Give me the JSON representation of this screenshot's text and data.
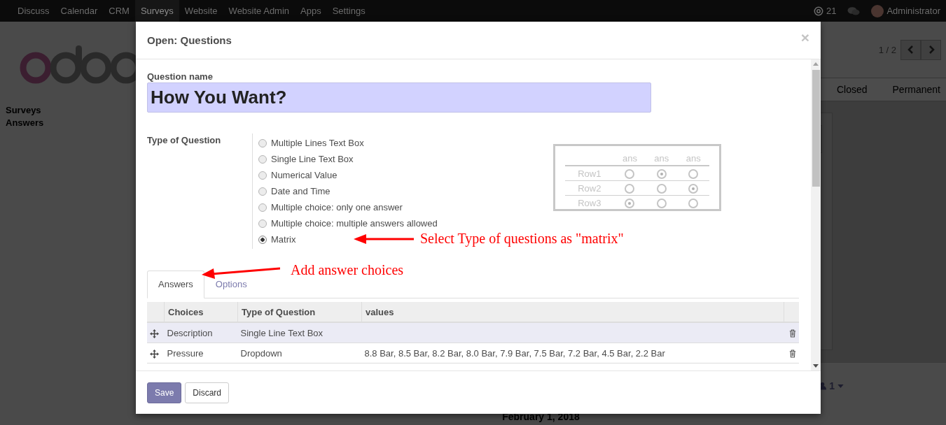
{
  "navbar": {
    "menu": [
      {
        "label": "Discuss",
        "selected": false
      },
      {
        "label": "Calendar",
        "selected": false
      },
      {
        "label": "CRM",
        "selected": false
      },
      {
        "label": "Surveys",
        "selected": true
      },
      {
        "label": "Website",
        "selected": false
      },
      {
        "label": "Website Admin",
        "selected": false
      },
      {
        "label": "Apps",
        "selected": false
      },
      {
        "label": "Settings",
        "selected": false
      }
    ],
    "notification_count": "21",
    "user": "Administrator"
  },
  "sidebar": {
    "items": [
      "Surveys",
      "Answers"
    ]
  },
  "pager": "1 / 2",
  "status_bar": {
    "stages": [
      "Closed",
      "Permanent"
    ]
  },
  "chatter": {
    "followers": "1",
    "date": "February 1, 2018"
  },
  "dialog": {
    "title": "Open: Questions",
    "close": "×",
    "question_name": {
      "label": "Question name",
      "value": "How You Want?"
    },
    "type_of_question": {
      "label": "Type of Question",
      "options": [
        {
          "label": "Multiple Lines Text Box",
          "selected": false
        },
        {
          "label": "Single Line Text Box",
          "selected": false
        },
        {
          "label": "Numerical Value",
          "selected": false
        },
        {
          "label": "Date and Time",
          "selected": false
        },
        {
          "label": "Multiple choice: only one answer",
          "selected": false
        },
        {
          "label": "Multiple choice: multiple answers allowed",
          "selected": false
        },
        {
          "label": "Matrix",
          "selected": true
        }
      ]
    },
    "matrix_preview": {
      "columns": [
        "ans",
        "ans",
        "ans"
      ],
      "rows": [
        {
          "label": "Row1",
          "cells": [
            {
              "selected": false
            },
            {
              "selected": true
            },
            {
              "selected": false
            }
          ]
        },
        {
          "label": "Row2",
          "cells": [
            {
              "selected": false
            },
            {
              "selected": false
            },
            {
              "selected": true
            }
          ]
        },
        {
          "label": "Row3",
          "cells": [
            {
              "selected": true
            },
            {
              "selected": false
            },
            {
              "selected": false
            }
          ]
        }
      ]
    },
    "annotations": [
      {
        "text": "Select Type of questions as \"matrix\""
      },
      {
        "text": "Add answer choices"
      }
    ],
    "tabs": [
      {
        "label": "Answers",
        "selected": true
      },
      {
        "label": "Options",
        "selected": false
      }
    ],
    "table": {
      "columns": [
        "Choices",
        "Type of Question",
        "values"
      ],
      "rows": [
        {
          "choice": "Description",
          "type": "Single Line Text Box",
          "selected": true
        },
        {
          "choice": "Pressure",
          "type": "Dropdown",
          "values": "8.8 Bar, 8.5 Bar, 8.2 Bar, 8.0 Bar, 7.9 Bar, 7.5 Bar, 7.2 Bar, 4.5 Bar, 2.2 Bar",
          "selected": false
        }
      ]
    },
    "buttons": [
      {
        "label": "Save",
        "kind": "primary"
      },
      {
        "label": "Discard",
        "kind": "secondary"
      }
    ]
  }
}
